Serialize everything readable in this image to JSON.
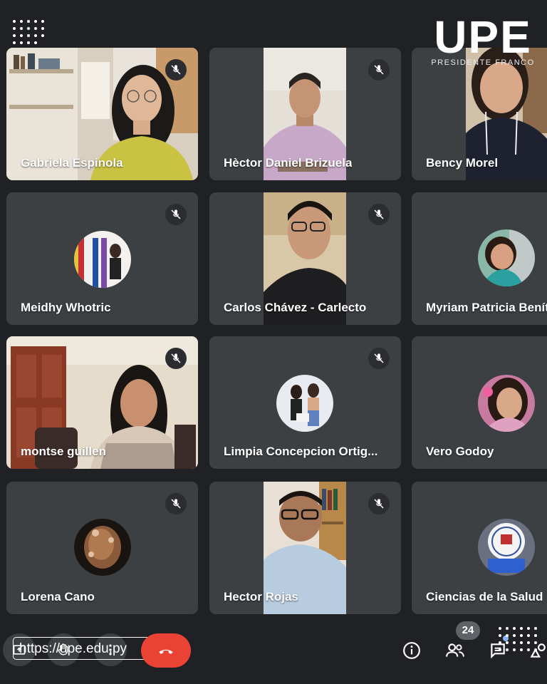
{
  "brand": {
    "logo_text": "UPE",
    "logo_subtitle": "PRESIDENTE FRANCO",
    "url": "https://upe.edu.py"
  },
  "participants": [
    {
      "name": "Gabriela Espinola",
      "muted": true,
      "type": "video"
    },
    {
      "name": "Hèctor Daniel Brizuela",
      "muted": true,
      "type": "video"
    },
    {
      "name": "Bency Morel",
      "muted": false,
      "type": "video"
    },
    {
      "name": "Meidhy Whotric",
      "muted": true,
      "type": "avatar"
    },
    {
      "name": "Carlos Chávez - Carlecto",
      "muted": true,
      "type": "video"
    },
    {
      "name": "Myriam Patricia Benítez",
      "muted": false,
      "type": "avatar"
    },
    {
      "name": "montse guillen",
      "muted": true,
      "type": "video"
    },
    {
      "name": "Limpia Concepcion Ortig...",
      "muted": true,
      "type": "avatar"
    },
    {
      "name": "Vero Godoy",
      "muted": false,
      "type": "avatar"
    },
    {
      "name": "Lorena Cano",
      "muted": true,
      "type": "avatar"
    },
    {
      "name": "Hector Rojas",
      "muted": true,
      "type": "video"
    },
    {
      "name": "Ciencias de la Salud",
      "muted": false,
      "type": "avatar"
    }
  ],
  "controls": {
    "participant_count": "24",
    "icons": [
      "present-icon",
      "raise-hand-icon",
      "more-options-icon",
      "hang-up-icon",
      "info-icon",
      "people-icon",
      "chat-icon",
      "activities-icon"
    ]
  },
  "colors": {
    "background": "#202124",
    "tile": "#3c4043",
    "hangup": "#ea4335",
    "accent": "#8ab4f8"
  }
}
